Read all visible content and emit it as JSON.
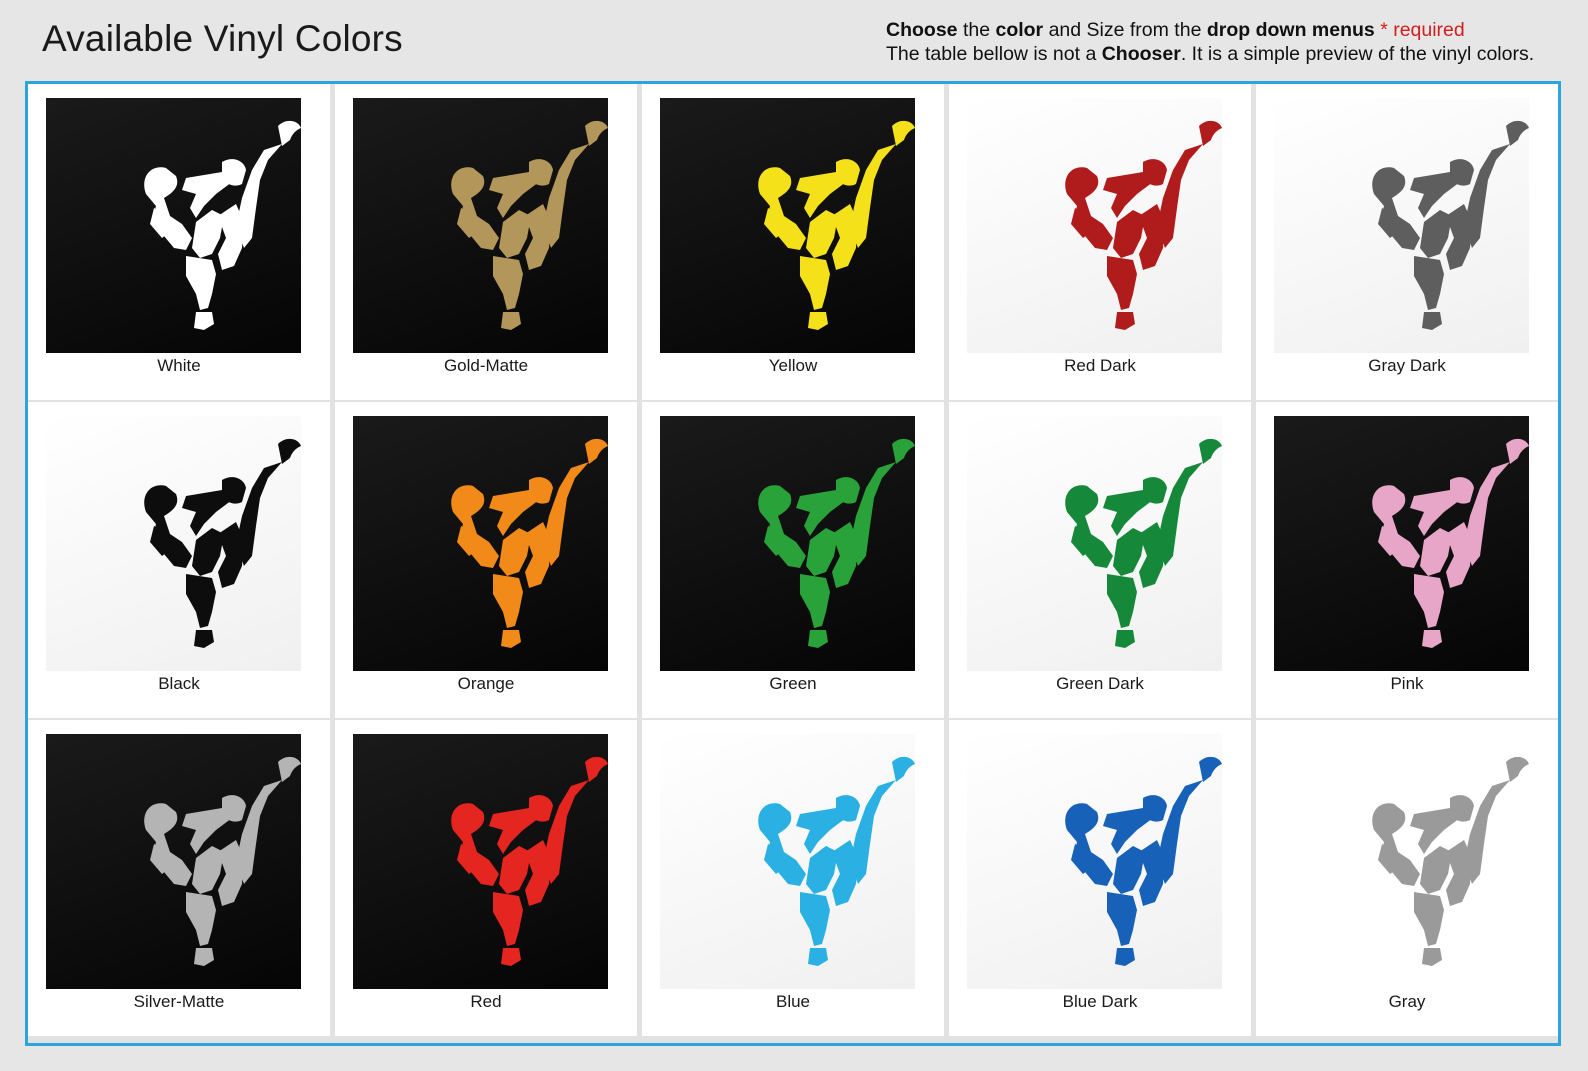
{
  "header": {
    "title": "Available Vinyl Colors",
    "line1_choose": "Choose",
    "line1_the": "the",
    "line1_color": "color",
    "line1_andsize": "and Size from the",
    "line1_menus": "drop down menus",
    "line1_required": "* required",
    "line2_a": "The table bellow is not a",
    "line2_chooser": "Chooser",
    "line2_b": ". It is a simple preview of the vinyl colors."
  },
  "swatches": [
    {
      "label": "White",
      "color": "#ffffff",
      "bg": "dark"
    },
    {
      "label": "Gold-Matte",
      "color": "#b39659",
      "bg": "dark"
    },
    {
      "label": "Yellow",
      "color": "#f5e11a",
      "bg": "dark"
    },
    {
      "label": "Red Dark",
      "color": "#b01b1b",
      "bg": "light"
    },
    {
      "label": "Gray Dark",
      "color": "#5e5e5e",
      "bg": "light"
    },
    {
      "label": "Black",
      "color": "#0d0d0d",
      "bg": "light"
    },
    {
      "label": "Orange",
      "color": "#f28a1a",
      "bg": "dark"
    },
    {
      "label": "Green",
      "color": "#2aa23a",
      "bg": "dark"
    },
    {
      "label": "Green Dark",
      "color": "#15883a",
      "bg": "light"
    },
    {
      "label": "Pink",
      "color": "#e7a6c8",
      "bg": "dark"
    },
    {
      "label": "Silver-Matte",
      "color": "#b4b4b4",
      "bg": "dark"
    },
    {
      "label": "Red",
      "color": "#e5251f",
      "bg": "dark"
    },
    {
      "label": "Blue",
      "color": "#2ab0e3",
      "bg": "light"
    },
    {
      "label": "Blue Dark",
      "color": "#1761b8",
      "bg": "light"
    },
    {
      "label": "Gray",
      "color": "#9a9a9a",
      "bg": "none"
    }
  ]
}
